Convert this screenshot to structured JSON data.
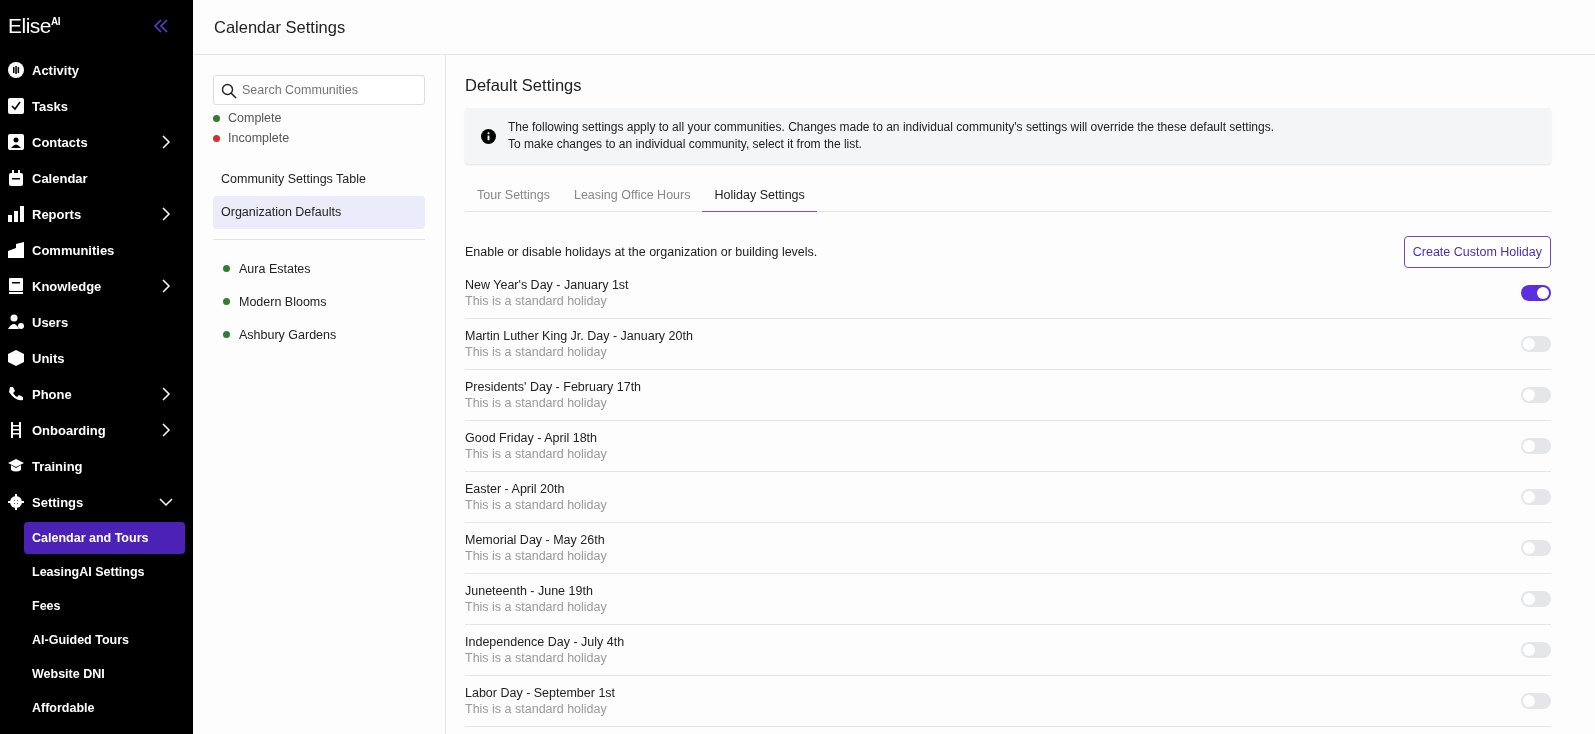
{
  "brand": {
    "name": "Elise",
    "suffix": "AI"
  },
  "nav": [
    {
      "label": "Activity"
    },
    {
      "label": "Tasks"
    },
    {
      "label": "Contacts",
      "expanded": false
    },
    {
      "label": "Calendar"
    },
    {
      "label": "Reports",
      "expanded": false
    },
    {
      "label": "Communities"
    },
    {
      "label": "Knowledge",
      "expanded": false
    },
    {
      "label": "Users"
    },
    {
      "label": "Units"
    },
    {
      "label": "Phone",
      "expanded": false
    },
    {
      "label": "Onboarding",
      "expanded": false
    },
    {
      "label": "Training"
    },
    {
      "label": "Settings",
      "expanded": true,
      "children": [
        {
          "label": "Calendar and Tours",
          "selected": true
        },
        {
          "label": "LeasingAI Settings",
          "selected": false
        },
        {
          "label": "Fees",
          "selected": false
        },
        {
          "label": "AI-Guided Tours",
          "selected": false
        },
        {
          "label": "Website DNI",
          "selected": false
        },
        {
          "label": "Affordable",
          "selected": false
        }
      ]
    }
  ],
  "page_title": "Calendar Settings",
  "communities": {
    "search": {
      "placeholder": "Search Communities"
    },
    "legend": [
      {
        "label": "Complete",
        "color": "#2e7d32"
      },
      {
        "label": "Incomplete",
        "color": "#d32f2f"
      }
    ],
    "views": [
      {
        "label": "Community Settings Table",
        "selected": false
      },
      {
        "label": "Organization Defaults",
        "selected": true
      }
    ],
    "items": [
      {
        "label": "Aura Estates",
        "color": "#2e7d32"
      },
      {
        "label": "Modern Blooms",
        "color": "#2e7d32"
      },
      {
        "label": "Ashbury Gardens",
        "color": "#2e7d32"
      }
    ]
  },
  "defaults": {
    "title": "Default Settings",
    "info": [
      "The following settings apply to all your communities. Changes made to an individual community's settings will override the these default settings.",
      "To make changes to an individual community, select it from the list."
    ],
    "tabs": [
      {
        "label": "Tour Settings",
        "selected": false
      },
      {
        "label": "Leasing Office Hours",
        "selected": false
      },
      {
        "label": "Holiday Settings",
        "selected": true
      }
    ],
    "description": "Enable or disable holidays at the organization or building levels.",
    "create_button": "Create Custom Holiday",
    "holidays": [
      {
        "name": "New Year's Day - January 1st",
        "note": "This is a standard holiday",
        "on": true
      },
      {
        "name": "Martin Luther King Jr. Day - January 20th",
        "note": "This is a standard holiday",
        "on": false
      },
      {
        "name": "Presidents' Day - February 17th",
        "note": "This is a standard holiday",
        "on": false
      },
      {
        "name": "Good Friday - April 18th",
        "note": "This is a standard holiday",
        "on": false
      },
      {
        "name": "Easter - April 20th",
        "note": "This is a standard holiday",
        "on": false
      },
      {
        "name": "Memorial Day - May 26th",
        "note": "This is a standard holiday",
        "on": false
      },
      {
        "name": "Juneteenth - June 19th",
        "note": "This is a standard holiday",
        "on": false
      },
      {
        "name": "Independence Day - July 4th",
        "note": "This is a standard holiday",
        "on": false
      },
      {
        "name": "Labor Day - September 1st",
        "note": "This is a standard holiday",
        "on": false
      }
    ]
  }
}
